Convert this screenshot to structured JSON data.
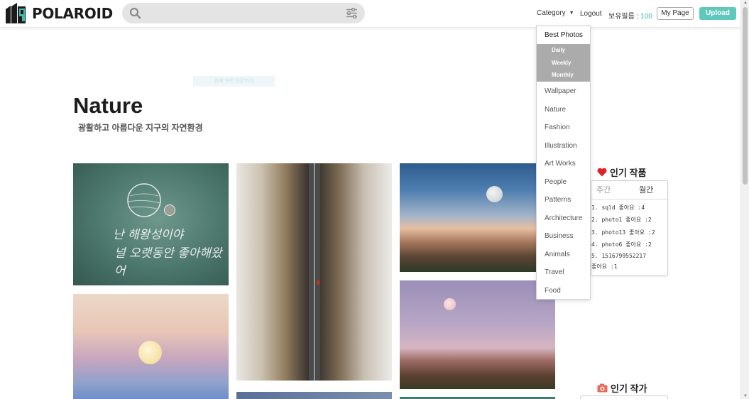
{
  "header": {
    "brand": "POLAROID",
    "search_placeholder": "",
    "category_label": "Category",
    "logout_label": "Logout",
    "points_label": "보유필름 : ",
    "points_value": "100",
    "mypage_label": "My Page",
    "upload_label": "Upload"
  },
  "banner_text": "전체 화면 전환하기",
  "page": {
    "title": "Nature",
    "subtitle": "광활하고 아름다운 지구의 자연환경"
  },
  "photo1_text": {
    "line1": "난 해왕성이야",
    "line2": "널 오랫동안 좋아해왔어"
  },
  "category_menu": {
    "best": "Best Photos",
    "best_sub": [
      "Daily",
      "Weekly",
      "Monthly"
    ],
    "items": [
      "Wallpaper",
      "Nature",
      "Fashion",
      "Illustration",
      "Art Works",
      "People",
      "Patterns",
      "Architecture",
      "Business",
      "Animals",
      "Travel",
      "Food"
    ]
  },
  "popular_works": {
    "title": "인기 작품",
    "tab_weekly": "주간",
    "tab_monthly": "월간",
    "rows": [
      "1.   sqld 좋아요 :4",
      "2. photo1 좋아요 :2",
      "3. photo13 좋아요 :2",
      "4. photo6 좋아요 :2",
      "5. 1516799552217",
      "      좋아요 :1"
    ]
  },
  "popular_artists": {
    "title": "인기 작가"
  },
  "colors": {
    "accent": "#5fc8bc",
    "points": "#3cbcb0",
    "menu_highlight": "#ababab",
    "heart": "#e0202a"
  }
}
